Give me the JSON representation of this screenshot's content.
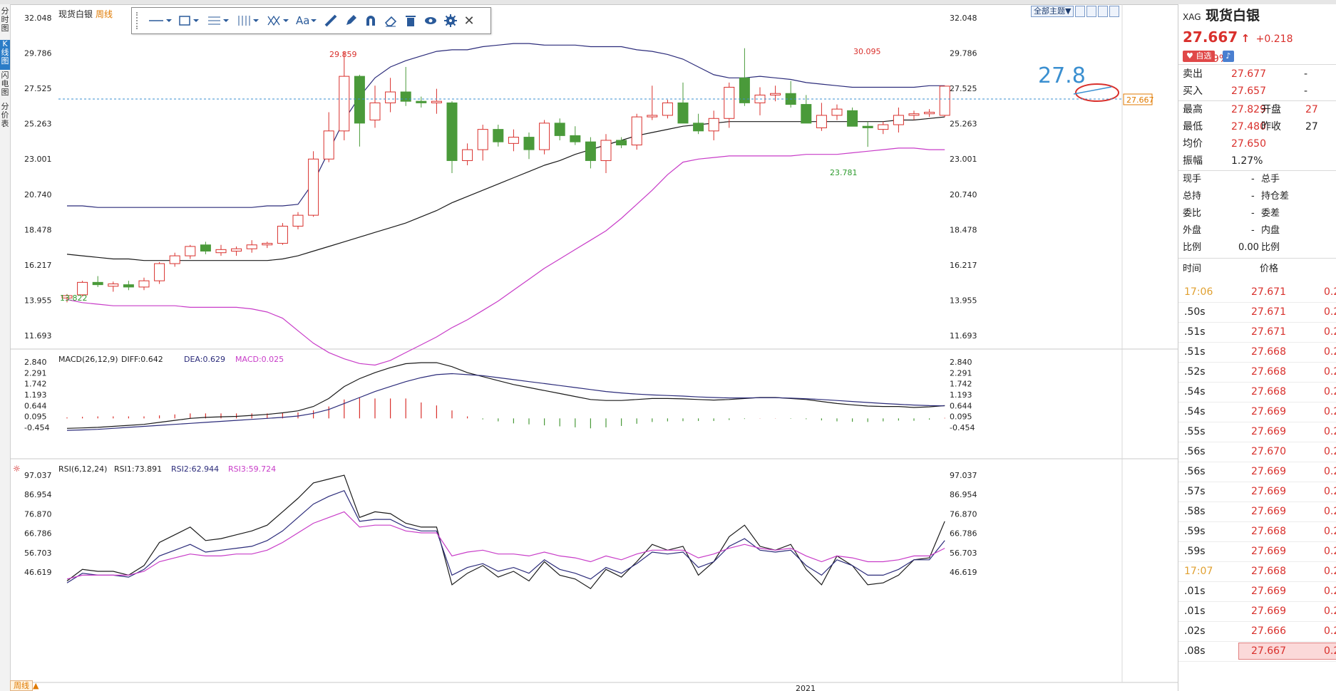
{
  "app": {
    "title": "现货白银",
    "period_label": "周线"
  },
  "left_tabs": [
    "分时图",
    "K线图",
    "闪电图",
    "分价表"
  ],
  "toolbar": {
    "tools": [
      "line-tool-icon",
      "rect-tool-icon",
      "fib-tool-icon",
      "channel-tool-icon",
      "pattern-tool-icon",
      "text-tool-icon",
      "ruler-icon",
      "pen-icon",
      "magnet-icon",
      "eraser-icon",
      "trash-icon",
      "eye-icon",
      "gear-icon",
      "close-icon"
    ],
    "text_tool_label": "Aa"
  },
  "theme_button": "全部主题▼",
  "price_axis": [
    "32.048",
    "29.786",
    "27.525",
    "25.263",
    "23.001",
    "20.740",
    "18.478",
    "16.217",
    "13.955",
    "11.693"
  ],
  "macd_axis": [
    "2.840",
    "2.291",
    "1.742",
    "1.193",
    "0.644",
    "0.095",
    "-0.454"
  ],
  "rsi_axis": [
    "97.037",
    "86.954",
    "76.870",
    "66.786",
    "56.703",
    "46.619"
  ],
  "annotations": {
    "high_label": "29.859",
    "high2_label": "30.095",
    "low_label": "13.822",
    "low2_label": "23.781",
    "note_price": "27.8",
    "current_price_tag": "27.667"
  },
  "macd": {
    "title": "MACD(26,12,9)",
    "diff": "DIFF:0.642",
    "dea": "DEA:0.629",
    "macd": "MACD:0.025"
  },
  "rsi": {
    "title": "RSI(6,12,24)",
    "rsi1": "RSI1:73.891",
    "rsi2": "RSI2:62.944",
    "rsi3": "RSI3:59.724"
  },
  "x_axis": {
    "year_label": "2021"
  },
  "colors": {
    "up": "#d9302c",
    "down": "#4a9a3a",
    "upper_band": "#2b2b7a",
    "mid": "#1a1a1a",
    "lower_band": "#c83cc8",
    "dea": "#2b2b7a",
    "macd_text": "#c83cc8",
    "note": "#3a8fd0"
  },
  "quote": {
    "code": "XAG",
    "name": "现货白银",
    "price": "27.667",
    "arrow": "↑",
    "change": "+0.218",
    "change_pct": "+0.79%",
    "fav_button": "自选",
    "sell_label": "卖出",
    "sell": "27.677",
    "sell_vol": "-",
    "buy_label": "买入",
    "buy": "27.657",
    "buy_vol": "-",
    "high_label": "最高",
    "high": "27.829",
    "open_label": "开盘",
    "open": "27",
    "low_label": "最低",
    "low": "27.480",
    "prev_label": "昨收",
    "prev": "27",
    "avg_label": "均价",
    "avg": "27.650",
    "amp_label": "振幅",
    "amp": "1.27%",
    "now_vol_label": "现手",
    "now_vol": "-",
    "total_vol_label": "总手",
    "total_hold_label": "总持",
    "total_hold": "-",
    "hold_diff_label": "持仓差",
    "ratio_label": "委比",
    "ratio": "-",
    "diff_label": "委差",
    "outer_label": "外盘",
    "outer": "-",
    "inner_label": "内盘",
    "pct_label": "比例",
    "pct": "0.00",
    "pct2_label": "比例"
  },
  "ticks_header": {
    "time": "时间",
    "price": "价格"
  },
  "ticks": [
    {
      "t": "17:06",
      "p": "27.671",
      "v": "0.2"
    },
    {
      "t": ".50s",
      "p": "27.671",
      "v": "0.2"
    },
    {
      "t": ".51s",
      "p": "27.671",
      "v": "0.2"
    },
    {
      "t": ".51s",
      "p": "27.668",
      "v": "0.2"
    },
    {
      "t": ".52s",
      "p": "27.668",
      "v": "0.2"
    },
    {
      "t": ".54s",
      "p": "27.668",
      "v": "0.2"
    },
    {
      "t": ".54s",
      "p": "27.669",
      "v": "0.2"
    },
    {
      "t": ".55s",
      "p": "27.669",
      "v": "0.2"
    },
    {
      "t": ".56s",
      "p": "27.670",
      "v": "0.2"
    },
    {
      "t": ".56s",
      "p": "27.669",
      "v": "0.2"
    },
    {
      "t": ".57s",
      "p": "27.669",
      "v": "0.2"
    },
    {
      "t": ".58s",
      "p": "27.669",
      "v": "0.2"
    },
    {
      "t": ".59s",
      "p": "27.668",
      "v": "0.2"
    },
    {
      "t": ".59s",
      "p": "27.669",
      "v": "0.2"
    },
    {
      "t": "17:07",
      "p": "27.668",
      "v": "0.2"
    },
    {
      "t": ".01s",
      "p": "27.669",
      "v": "0.2"
    },
    {
      "t": ".01s",
      "p": "27.669",
      "v": "0.2"
    },
    {
      "t": ".02s",
      "p": "27.666",
      "v": "0.2"
    },
    {
      "t": ".08s",
      "p": "27.667",
      "v": "0.2"
    }
  ],
  "candles": [
    {
      "o": 14.1,
      "h": 14.35,
      "l": 13.82,
      "c": 14.25
    },
    {
      "o": 14.3,
      "h": 15.2,
      "l": 14.2,
      "c": 15.1
    },
    {
      "o": 15.1,
      "h": 15.5,
      "l": 14.8,
      "c": 14.95
    },
    {
      "o": 14.85,
      "h": 15.15,
      "l": 14.5,
      "c": 15.0
    },
    {
      "o": 14.95,
      "h": 15.2,
      "l": 14.6,
      "c": 14.8
    },
    {
      "o": 14.8,
      "h": 15.4,
      "l": 14.6,
      "c": 15.2
    },
    {
      "o": 15.2,
      "h": 16.4,
      "l": 15.0,
      "c": 16.3
    },
    {
      "o": 16.3,
      "h": 17.0,
      "l": 16.1,
      "c": 16.8
    },
    {
      "o": 16.8,
      "h": 17.5,
      "l": 16.6,
      "c": 17.4
    },
    {
      "o": 17.5,
      "h": 17.7,
      "l": 16.9,
      "c": 17.1
    },
    {
      "o": 17.0,
      "h": 17.5,
      "l": 16.8,
      "c": 17.2
    },
    {
      "o": 17.1,
      "h": 17.4,
      "l": 16.8,
      "c": 17.25
    },
    {
      "o": 17.25,
      "h": 17.8,
      "l": 17.0,
      "c": 17.5
    },
    {
      "o": 17.5,
      "h": 17.7,
      "l": 17.3,
      "c": 17.6
    },
    {
      "o": 17.6,
      "h": 18.9,
      "l": 17.5,
      "c": 18.7
    },
    {
      "o": 18.7,
      "h": 19.6,
      "l": 18.5,
      "c": 19.4
    },
    {
      "o": 19.4,
      "h": 23.5,
      "l": 19.3,
      "c": 23.0
    },
    {
      "o": 23.0,
      "h": 26.0,
      "l": 22.8,
      "c": 24.8
    },
    {
      "o": 24.8,
      "h": 29.86,
      "l": 24.2,
      "c": 28.3
    },
    {
      "o": 28.3,
      "h": 28.4,
      "l": 23.8,
      "c": 25.3
    },
    {
      "o": 25.5,
      "h": 27.7,
      "l": 25.0,
      "c": 26.6
    },
    {
      "o": 26.6,
      "h": 28.2,
      "l": 26.0,
      "c": 27.3
    },
    {
      "o": 27.3,
      "h": 28.9,
      "l": 26.4,
      "c": 26.7
    },
    {
      "o": 26.7,
      "h": 27.0,
      "l": 26.3,
      "c": 26.6
    },
    {
      "o": 26.6,
      "h": 27.5,
      "l": 25.9,
      "c": 26.7
    },
    {
      "o": 26.6,
      "h": 26.7,
      "l": 22.1,
      "c": 22.9
    },
    {
      "o": 22.9,
      "h": 24.0,
      "l": 22.6,
      "c": 23.6
    },
    {
      "o": 23.6,
      "h": 25.2,
      "l": 22.9,
      "c": 24.9
    },
    {
      "o": 24.9,
      "h": 25.2,
      "l": 23.8,
      "c": 24.1
    },
    {
      "o": 24.0,
      "h": 24.9,
      "l": 23.5,
      "c": 24.4
    },
    {
      "o": 24.4,
      "h": 24.7,
      "l": 23.0,
      "c": 23.6
    },
    {
      "o": 23.6,
      "h": 25.5,
      "l": 23.3,
      "c": 25.3
    },
    {
      "o": 25.3,
      "h": 25.6,
      "l": 24.2,
      "c": 24.5
    },
    {
      "o": 24.5,
      "h": 25.1,
      "l": 23.9,
      "c": 24.1
    },
    {
      "o": 24.1,
      "h": 24.4,
      "l": 22.4,
      "c": 22.9
    },
    {
      "o": 22.9,
      "h": 24.6,
      "l": 22.1,
      "c": 24.2
    },
    {
      "o": 24.2,
      "h": 24.4,
      "l": 23.7,
      "c": 23.9
    },
    {
      "o": 23.9,
      "h": 25.9,
      "l": 23.6,
      "c": 25.7
    },
    {
      "o": 25.7,
      "h": 27.7,
      "l": 25.5,
      "c": 25.8
    },
    {
      "o": 25.8,
      "h": 26.8,
      "l": 25.6,
      "c": 26.6
    },
    {
      "o": 26.6,
      "h": 27.9,
      "l": 25.8,
      "c": 25.3
    },
    {
      "o": 25.3,
      "h": 25.9,
      "l": 24.6,
      "c": 24.8
    },
    {
      "o": 24.8,
      "h": 26.1,
      "l": 24.2,
      "c": 25.6
    },
    {
      "o": 25.6,
      "h": 27.9,
      "l": 25.0,
      "c": 27.6
    },
    {
      "o": 28.2,
      "h": 30.1,
      "l": 26.4,
      "c": 26.6
    },
    {
      "o": 26.6,
      "h": 27.6,
      "l": 25.8,
      "c": 27.1
    },
    {
      "o": 27.1,
      "h": 27.7,
      "l": 26.7,
      "c": 27.2
    },
    {
      "o": 27.2,
      "h": 28.0,
      "l": 26.3,
      "c": 26.5
    },
    {
      "o": 26.5,
      "h": 27.1,
      "l": 25.4,
      "c": 25.3
    },
    {
      "o": 25.0,
      "h": 26.6,
      "l": 24.8,
      "c": 25.8
    },
    {
      "o": 25.8,
      "h": 26.5,
      "l": 25.5,
      "c": 26.2
    },
    {
      "o": 26.1,
      "h": 26.3,
      "l": 25.1,
      "c": 25.1
    },
    {
      "o": 25.1,
      "h": 25.4,
      "l": 23.78,
      "c": 25.0
    },
    {
      "o": 24.9,
      "h": 25.4,
      "l": 24.6,
      "c": 25.2
    },
    {
      "o": 25.2,
      "h": 26.3,
      "l": 24.7,
      "c": 25.8
    },
    {
      "o": 25.8,
      "h": 26.1,
      "l": 25.5,
      "c": 25.9
    },
    {
      "o": 25.9,
      "h": 26.2,
      "l": 25.7,
      "c": 26.0
    },
    {
      "o": 25.8,
      "h": 27.7,
      "l": 25.7,
      "c": 27.67
    }
  ],
  "bands": {
    "upper": [
      20.0,
      20.0,
      19.9,
      19.9,
      19.9,
      19.9,
      19.9,
      19.9,
      19.9,
      19.9,
      19.9,
      19.9,
      19.9,
      20.0,
      20.0,
      20.1,
      21.5,
      23.5,
      25.5,
      27.0,
      28.2,
      28.9,
      29.3,
      29.6,
      29.9,
      30.0,
      30.0,
      30.2,
      30.3,
      30.4,
      30.4,
      30.3,
      30.3,
      30.3,
      30.2,
      30.2,
      30.2,
      30.0,
      29.9,
      29.7,
      29.4,
      28.9,
      28.4,
      28.2,
      28.2,
      28.3,
      28.2,
      28.1,
      27.9,
      27.8,
      27.7,
      27.6,
      27.6,
      27.6,
      27.6,
      27.6,
      27.7,
      27.7
    ],
    "mid": [
      16.9,
      16.8,
      16.7,
      16.6,
      16.6,
      16.5,
      16.5,
      16.5,
      16.5,
      16.5,
      16.5,
      16.5,
      16.5,
      16.5,
      16.6,
      16.8,
      17.1,
      17.4,
      17.7,
      18.0,
      18.3,
      18.6,
      18.9,
      19.3,
      19.7,
      20.2,
      20.6,
      21.0,
      21.4,
      21.8,
      22.2,
      22.6,
      22.9,
      23.3,
      23.6,
      23.9,
      24.2,
      24.5,
      24.7,
      24.9,
      25.1,
      25.2,
      25.3,
      25.4,
      25.4,
      25.4,
      25.4,
      25.4,
      25.4,
      25.4,
      25.4,
      25.4,
      25.4,
      25.4,
      25.5,
      25.5,
      25.6,
      25.7
    ],
    "lower": [
      14.0,
      13.8,
      13.7,
      13.6,
      13.6,
      13.6,
      13.6,
      13.6,
      13.5,
      13.5,
      13.5,
      13.5,
      13.4,
      13.2,
      12.8,
      12.0,
      11.2,
      10.6,
      10.2,
      9.9,
      9.8,
      10.1,
      10.6,
      11.1,
      11.6,
      12.2,
      12.7,
      13.3,
      13.9,
      14.6,
      15.3,
      16.0,
      16.6,
      17.2,
      17.8,
      18.4,
      19.2,
      20.1,
      21.0,
      22.0,
      22.8,
      23.0,
      23.1,
      23.2,
      23.2,
      23.2,
      23.2,
      23.2,
      23.3,
      23.3,
      23.3,
      23.4,
      23.5,
      23.6,
      23.7,
      23.7,
      23.6,
      23.6
    ]
  },
  "macd_series": {
    "diff": [
      -0.5,
      -0.48,
      -0.45,
      -0.4,
      -0.35,
      -0.3,
      -0.2,
      -0.1,
      0.0,
      0.05,
      0.08,
      0.1,
      0.15,
      0.2,
      0.28,
      0.38,
      0.6,
      1.0,
      1.6,
      2.0,
      2.3,
      2.55,
      2.75,
      2.8,
      2.8,
      2.6,
      2.3,
      2.1,
      1.9,
      1.7,
      1.55,
      1.4,
      1.25,
      1.1,
      0.95,
      0.9,
      0.9,
      0.95,
      1.0,
      1.0,
      0.98,
      0.95,
      0.92,
      0.95,
      1.0,
      1.05,
      1.05,
      1.0,
      0.95,
      0.85,
      0.75,
      0.68,
      0.62,
      0.6,
      0.6,
      0.55,
      0.58,
      0.64
    ],
    "dea": [
      -0.6,
      -0.58,
      -0.55,
      -0.5,
      -0.45,
      -0.4,
      -0.35,
      -0.3,
      -0.25,
      -0.2,
      -0.15,
      -0.1,
      -0.05,
      0.0,
      0.05,
      0.12,
      0.25,
      0.45,
      0.75,
      1.05,
      1.35,
      1.6,
      1.85,
      2.05,
      2.2,
      2.25,
      2.2,
      2.15,
      2.05,
      1.95,
      1.85,
      1.75,
      1.65,
      1.55,
      1.45,
      1.35,
      1.28,
      1.22,
      1.18,
      1.15,
      1.12,
      1.08,
      1.05,
      1.03,
      1.03,
      1.04,
      1.04,
      1.02,
      0.99,
      0.95,
      0.9,
      0.85,
      0.8,
      0.75,
      0.71,
      0.67,
      0.64,
      0.63
    ],
    "hist": [
      0.05,
      0.08,
      0.1,
      0.1,
      0.1,
      0.1,
      0.15,
      0.2,
      0.25,
      0.25,
      0.25,
      0.25,
      0.25,
      0.25,
      0.3,
      0.3,
      0.4,
      0.6,
      0.95,
      1.05,
      1.0,
      1.0,
      1.0,
      0.8,
      0.65,
      0.4,
      0.1,
      -0.05,
      -0.15,
      -0.25,
      -0.3,
      -0.35,
      -0.4,
      -0.45,
      -0.5,
      -0.45,
      -0.38,
      -0.27,
      -0.18,
      -0.15,
      -0.14,
      -0.13,
      -0.13,
      -0.08,
      -0.03,
      0.01,
      0.01,
      -0.02,
      -0.04,
      -0.1,
      -0.15,
      -0.17,
      -0.18,
      -0.15,
      -0.11,
      -0.12,
      -0.06,
      0.025
    ]
  },
  "rsi_series": {
    "rsi1": [
      42,
      48,
      47,
      47,
      45,
      50,
      62,
      66,
      70,
      63,
      64,
      66,
      68,
      71,
      78,
      85,
      93,
      95,
      97,
      75,
      78,
      77,
      72,
      70,
      70,
      40,
      46,
      50,
      44,
      47,
      42,
      52,
      45,
      43,
      38,
      48,
      44,
      52,
      61,
      58,
      60,
      45,
      52,
      65,
      71,
      60,
      58,
      61,
      48,
      40,
      55,
      50,
      40,
      41,
      45,
      53,
      54,
      73
    ],
    "rsi2": [
      41,
      46,
      45,
      45,
      44,
      48,
      55,
      58,
      61,
      57,
      58,
      59,
      60,
      63,
      68,
      75,
      82,
      86,
      89,
      73,
      74,
      74,
      70,
      68,
      68,
      45,
      49,
      51,
      47,
      49,
      46,
      53,
      48,
      46,
      43,
      49,
      46,
      51,
      57,
      56,
      57,
      49,
      52,
      60,
      64,
      58,
      57,
      58,
      50,
      45,
      53,
      50,
      45,
      45,
      48,
      53,
      53,
      63
    ],
    "rsi3": [
      43,
      45,
      45,
      45,
      45,
      47,
      52,
      54,
      56,
      55,
      55,
      56,
      56,
      58,
      62,
      67,
      72,
      75,
      78,
      70,
      71,
      71,
      68,
      67,
      67,
      55,
      57,
      58,
      56,
      56,
      55,
      57,
      55,
      54,
      52,
      55,
      53,
      56,
      58,
      58,
      58,
      54,
      56,
      59,
      61,
      59,
      58,
      59,
      55,
      52,
      55,
      54,
      52,
      52,
      53,
      55,
      55,
      59
    ]
  }
}
